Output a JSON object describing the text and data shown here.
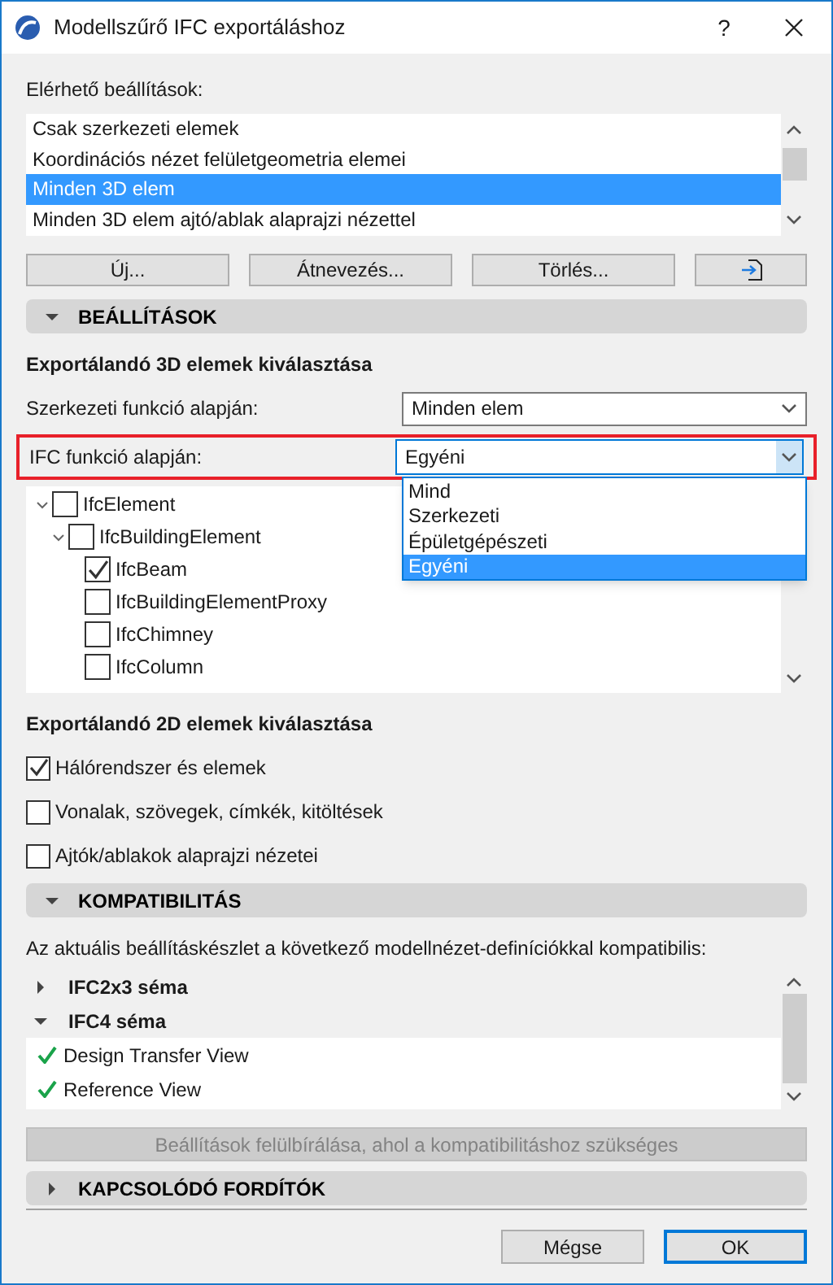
{
  "window": {
    "title": "Modellszűrő IFC exportáláshoz",
    "help": "?"
  },
  "presets": {
    "label": "Elérhető beállítások:",
    "items": [
      {
        "label": "Csak szerkezeti elemek",
        "selected": false
      },
      {
        "label": "Koordinációs nézet felületgeometria elemei",
        "selected": false
      },
      {
        "label": "Minden 3D elem",
        "selected": true
      },
      {
        "label": "Minden 3D elem ajtó/ablak alaprajzi nézettel",
        "selected": false
      }
    ],
    "buttons": [
      "Új...",
      "Átnevezés...",
      "Törlés..."
    ]
  },
  "settings": {
    "title": "BEÁLLÍTÁSOK",
    "expanded": true,
    "heading_3d": "Exportálandó 3D elemek kiválasztása",
    "structural": {
      "label": "Szerkezeti funkció alapján:",
      "value": "Minden elem"
    },
    "ifc": {
      "label": "IFC funkció alapján:",
      "value": "Egyéni",
      "highlighted": true,
      "open": true,
      "options": [
        {
          "label": "Mind",
          "selected": false
        },
        {
          "label": "Szerkezeti",
          "selected": false
        },
        {
          "label": "Épületgépészeti",
          "selected": false
        },
        {
          "label": "Egyéni",
          "selected": true
        }
      ]
    },
    "tree": [
      {
        "label": "IfcElement",
        "checked": false,
        "expanded": true,
        "children": [
          {
            "label": "IfcBuildingElement",
            "checked": false,
            "expanded": true,
            "children": [
              {
                "label": "IfcBeam",
                "checked": true
              },
              {
                "label": "IfcBuildingElementProxy",
                "checked": false
              },
              {
                "label": "IfcChimney",
                "checked": false
              },
              {
                "label": "IfcColumn",
                "checked": false
              }
            ]
          }
        ]
      }
    ],
    "heading_2d": "Exportálandó 2D elemek kiválasztása",
    "options_2d": [
      {
        "label": "Hálórendszer és elemek",
        "checked": true
      },
      {
        "label": "Vonalak, szövegek, címkék, kitöltések",
        "checked": false
      },
      {
        "label": "Ajtók/ablakok alaprajzi nézetei",
        "checked": false
      }
    ]
  },
  "compatibility": {
    "title": "KOMPATIBILITÁS",
    "expanded": true,
    "description": "Az aktuális beállításkészlet a következő modellnézet-definíciókkal kompatibilis:",
    "schemas": [
      {
        "label": "IFC2x3 séma",
        "expanded": false
      },
      {
        "label": "IFC4 séma",
        "expanded": true,
        "views": [
          "Design Transfer View",
          "Reference View"
        ]
      }
    ],
    "override_button": {
      "label": "Beállítások felülbírálása, ahol a kompatibilitáshoz szükséges",
      "disabled": true
    }
  },
  "translators": {
    "title": "KAPCSOLÓDÓ FORDÍTÓK",
    "expanded": false
  },
  "footer": {
    "buttons": [
      {
        "label": "Mégse",
        "default": false
      },
      {
        "label": "OK",
        "default": true
      }
    ]
  }
}
